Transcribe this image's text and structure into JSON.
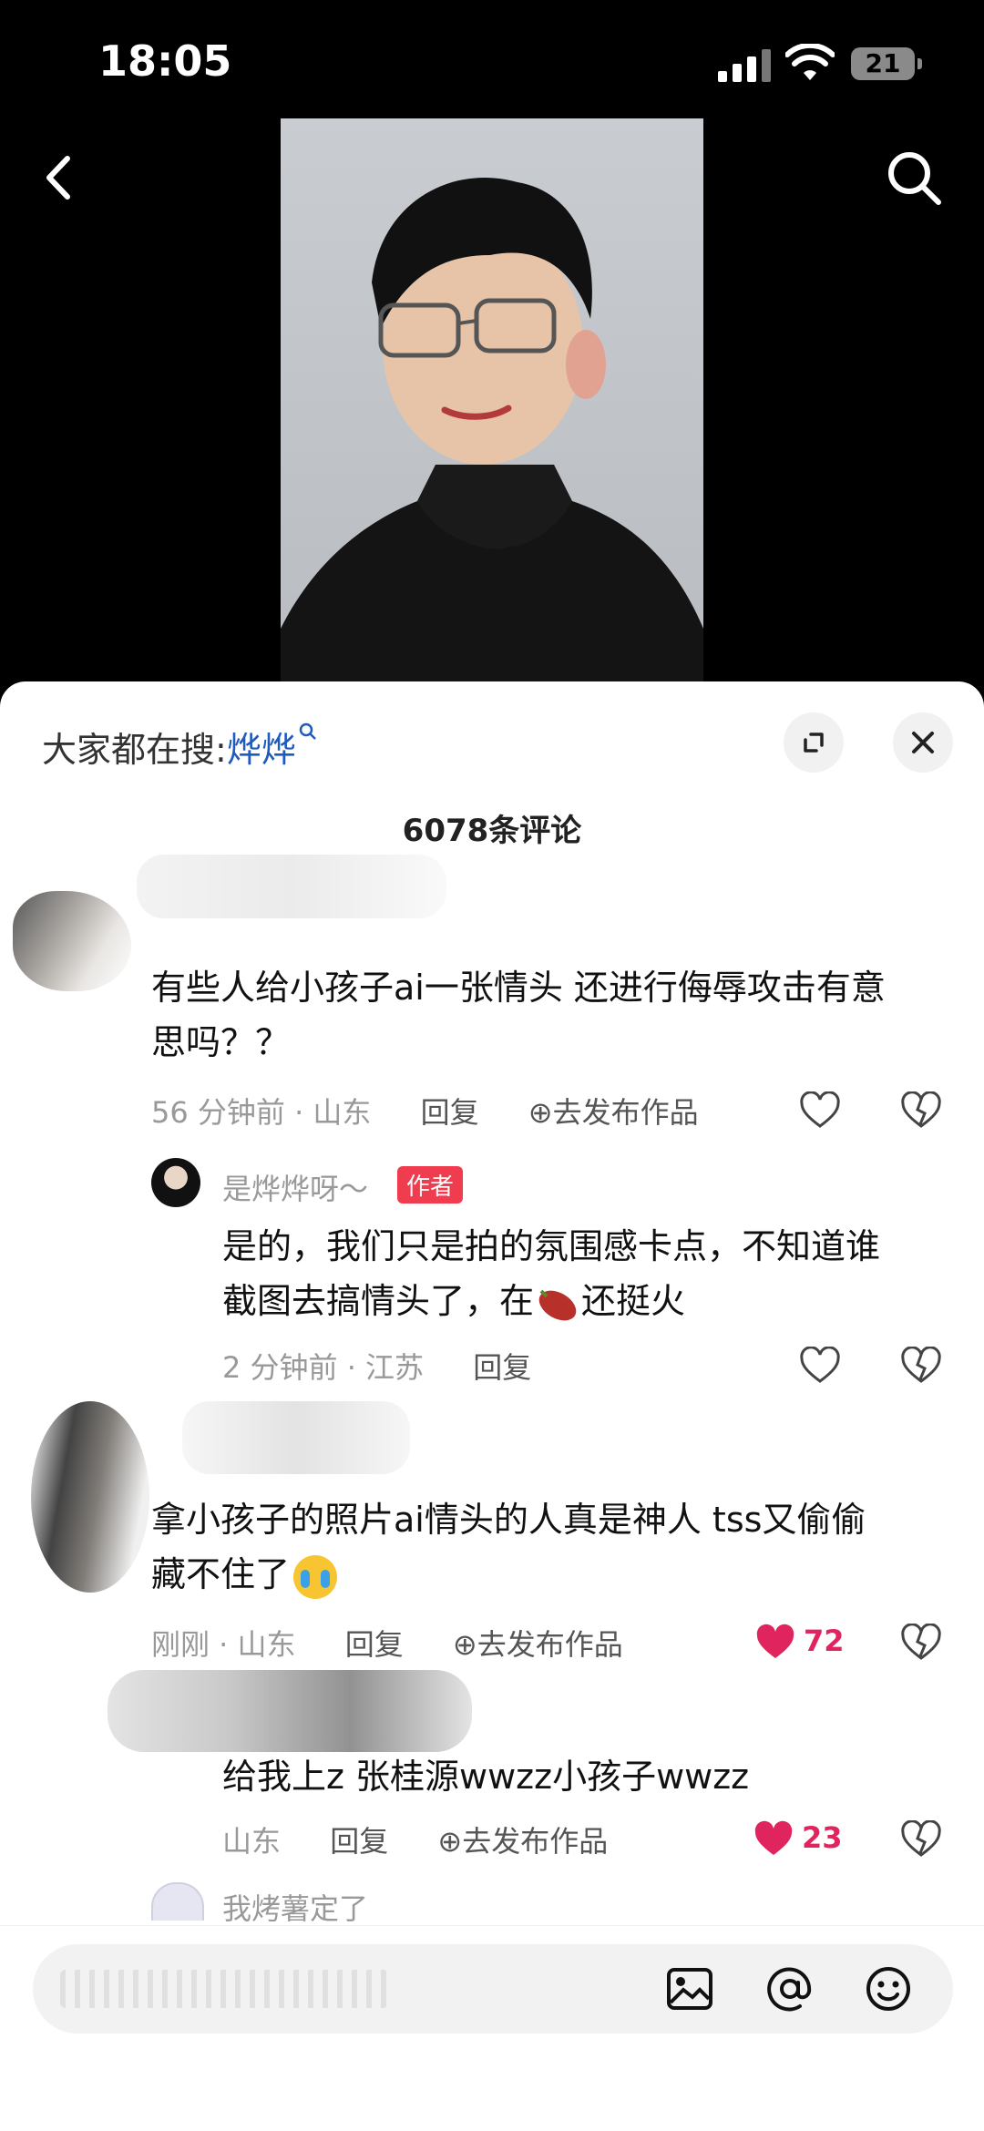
{
  "status_bar": {
    "time": "18:05",
    "battery": "21"
  },
  "hot_search": {
    "prefix": "大家都在搜:",
    "keyword": "烨烨"
  },
  "comments_header": {
    "count_label": "6078条评论"
  },
  "comments": [
    {
      "text_line1": "有些人给小孩子ai一张情头 还进行侮辱攻击有意",
      "text_line2": "思吗？？",
      "time_loc": "56 分钟前 · 山东",
      "reply": "回复",
      "publish": "去发布作品"
    },
    {
      "author": "是烨烨呀～",
      "author_badge": "作者",
      "text_line1": "是的，我们只是拍的氛围感卡点，不知道谁",
      "text_line2_a": "截图去搞情头了，在",
      "text_line2_b": "还挺火",
      "time_loc": "2 分钟前 · 江苏",
      "reply": "回复"
    },
    {
      "text_line1": "拿小孩子的照片ai情头的人真是神人 tss又偷偷",
      "text_line2": "藏不住了",
      "time_loc": "刚刚 · 山东",
      "reply": "回复",
      "publish": "去发布作品",
      "likes": "72"
    },
    {
      "text_line1": "给我上z 张桂源wwzz小孩子wwzz",
      "time_loc": "山东",
      "reply": "回复",
      "publish": "去发布作品",
      "likes": "23"
    },
    {
      "author": "我烤薯定了"
    }
  ],
  "colors": {
    "accent_blue": "#1e5bbf",
    "like_red": "#e0245e",
    "badge_red": "#f03c4f"
  }
}
